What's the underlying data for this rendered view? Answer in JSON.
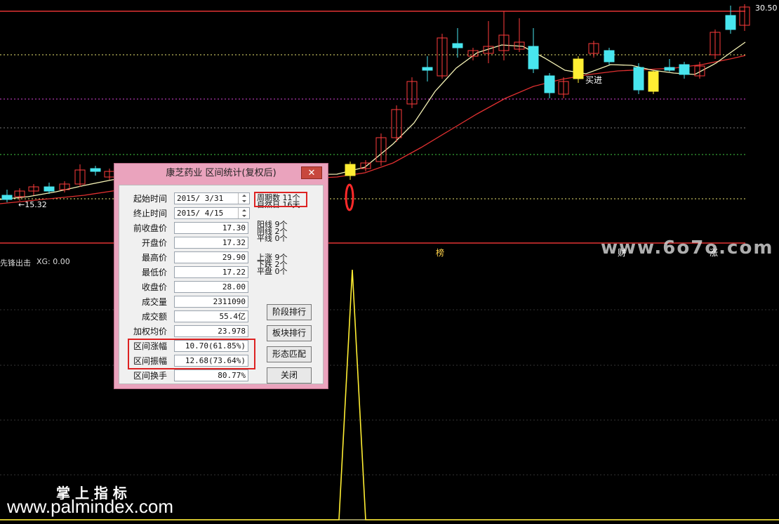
{
  "price_labels": {
    "high": "30.50",
    "low_marker": "←15.32",
    "buy_signal": "买进"
  },
  "indicator": {
    "name": "先锋出击",
    "value_label": "XG: 0.00"
  },
  "bottom_markers": [
    "榜",
    "财",
    "涨"
  ],
  "watermarks": {
    "top_right": "www.6o7o.com",
    "brand_cn": "掌 上 指 标",
    "brand_url": "www.palmindex.com"
  },
  "dialog": {
    "title": "康芝药业 区间统计(复权后)",
    "close_symbol": "✕",
    "start_label": "起始时间",
    "start_value": "2015/ 3/31",
    "end_label": "终止时间",
    "end_value": "2015/ 4/15",
    "rows": [
      {
        "label": "前收盘价",
        "value": "17.30"
      },
      {
        "label": "开盘价",
        "value": "17.32"
      },
      {
        "label": "最高价",
        "value": "29.90"
      },
      {
        "label": "最低价",
        "value": "17.22"
      },
      {
        "label": "收盘价",
        "value": "28.00"
      },
      {
        "label": "成交量",
        "value": "2311090"
      },
      {
        "label": "成交额",
        "value": "55.4亿"
      },
      {
        "label": "加权均价",
        "value": "23.978"
      },
      {
        "label": "区间涨幅",
        "value": "10.70(61.85%)"
      },
      {
        "label": "区间振幅",
        "value": "12.68(73.64%)"
      },
      {
        "label": "区间换手",
        "value": "80.77%"
      }
    ],
    "stats": {
      "periods": "周期数 11个",
      "natural_days": "自然日 16天",
      "yang": "阳线 9个",
      "yin": "阴线 2个",
      "flat_line": "平线 0个",
      "up": "上涨 9个",
      "down": "下跌 2个",
      "flat": "平盘 0个"
    },
    "buttons": {
      "rank": "阶段排行",
      "sector": "板块排行",
      "pattern": "形态匹配",
      "close": "关闭"
    }
  },
  "colors": {
    "up": "#ff3b3b",
    "down": "#48e5ee",
    "yellow": "#ffee33",
    "ma5": "#f5f2b5",
    "ma10": "#e03030"
  }
}
